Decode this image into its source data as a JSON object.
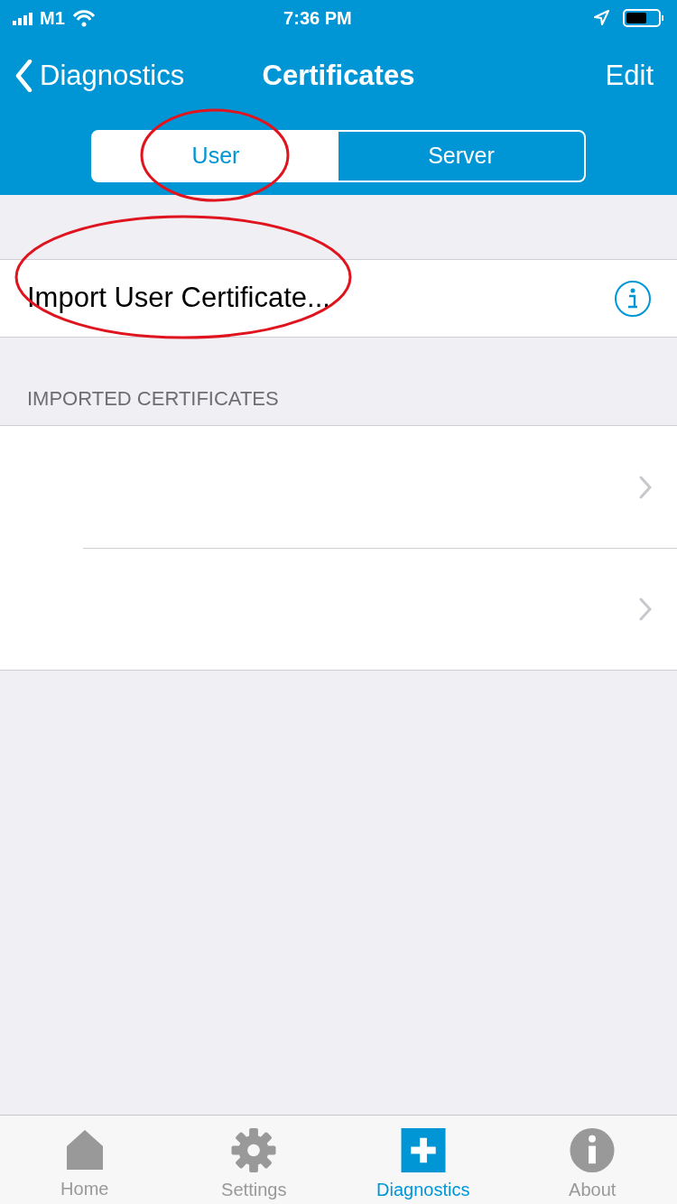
{
  "status_bar": {
    "carrier": "M1",
    "time": "7:36 PM"
  },
  "nav": {
    "back": "Diagnostics",
    "title": "Certificates",
    "action": "Edit"
  },
  "segments": [
    {
      "label": "User",
      "selected": true,
      "circled": true
    },
    {
      "label": "Server",
      "selected": false,
      "circled": false
    }
  ],
  "import_row": {
    "label": "Import User Certificate...",
    "circled": true
  },
  "imported": {
    "header": "IMPORTED CERTIFICATES",
    "rows": [
      {
        "kind": "certificate"
      },
      {
        "kind": "certificate"
      }
    ]
  },
  "tab_bar": [
    {
      "label": "Home",
      "kind": "home",
      "selected": false
    },
    {
      "label": "Settings",
      "kind": "gear",
      "selected": false
    },
    {
      "label": "Diagnostics",
      "kind": "plus",
      "selected": true
    },
    {
      "label": "About",
      "kind": "info",
      "selected": false
    }
  ]
}
